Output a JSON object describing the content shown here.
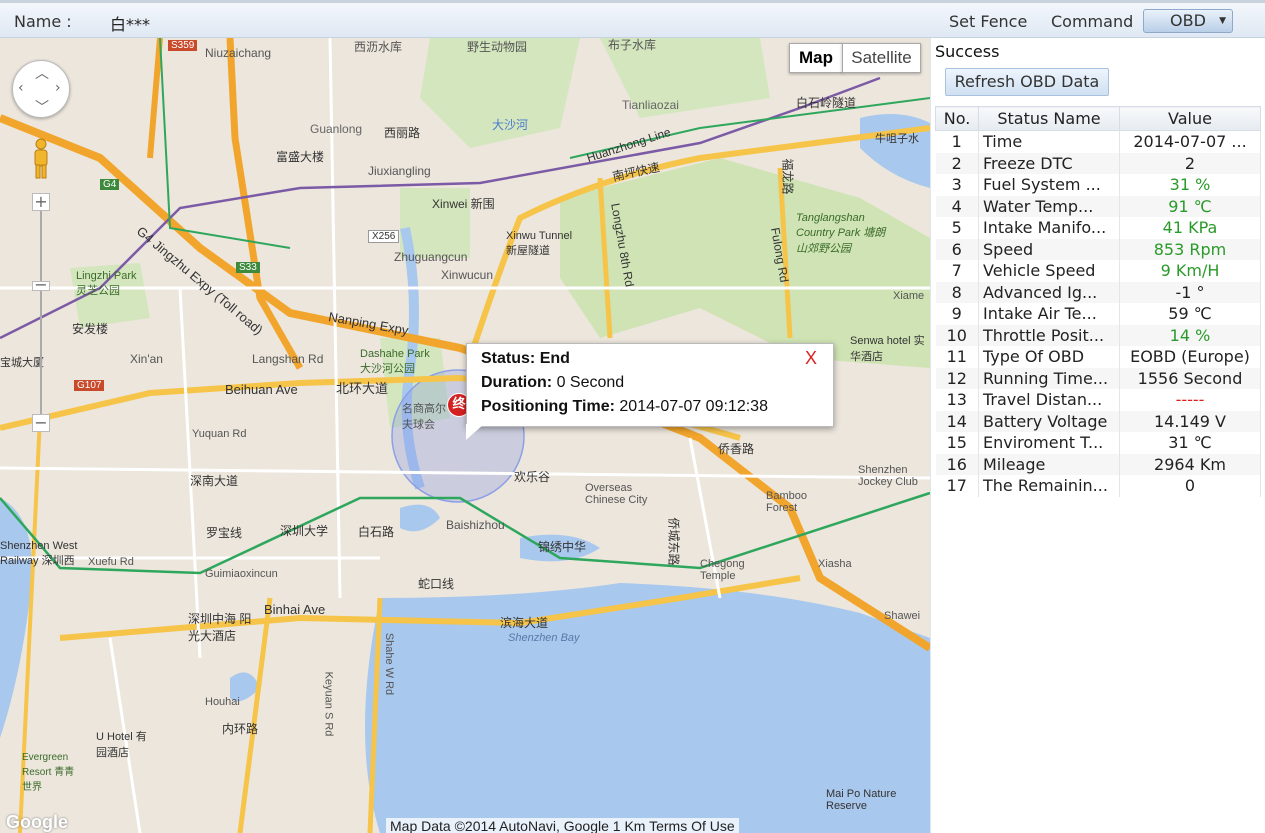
{
  "header": {
    "name_label": "Name :",
    "name_value": "白***",
    "set_fence": "Set Fence",
    "command": "Command",
    "obd_button": "OBD"
  },
  "map": {
    "type_map": "Map",
    "type_satellite": "Satellite",
    "infowindow": {
      "status_label": "Status:",
      "status_value": "End",
      "duration_label": "Duration:",
      "duration_value": "0 Second",
      "positioning_label": "Positioning Time:",
      "positioning_value": "2014-07-07 09:12:38",
      "close": "X"
    },
    "marker_text": "终",
    "google_logo": "Google",
    "footer": "Map Data ©2014 AutoNavi, Google  1 Km  Terms Of Use",
    "labels": [
      "Niuzaichang",
      "西沥水库",
      "野生动物园",
      "布子水库",
      "白石岭隧道",
      "Tianliaozai",
      "Guanlong",
      "西丽路",
      "富盛大楼",
      "Jiuxiangling",
      "Xinwei 新围",
      "大沙河",
      "Huanzhong Line",
      "南坪快速",
      "Xinwu Tunnel 新屋隧道",
      "Longzhu 8th Rd",
      "福龙路",
      "Fulong Rd",
      "Tanglangshan Country Park 塘朗山郊野公园",
      "牛咀子水",
      "Zhuguangcun",
      "Xinwucun",
      "Lingzhi Park 灵芝公园",
      "安发楼",
      "Xin'an",
      "Langshan Rd",
      "Dashahe Park 大沙河公园",
      "Nanping Expy",
      "G4 Jingzhu Expy (Toll road)",
      "Beihuan Ave",
      "北环大道",
      "名商高尔夫球会",
      "Yuquan Rd",
      "深南大道",
      "Overseas Chinese City",
      "欢乐谷",
      "侨香路",
      "Bamboo Forest",
      "Shenzhen Jockey Club",
      "深圳大学",
      "白石路",
      "Baishizhou",
      "锦绣中华",
      "罗宝线",
      "Shenzhen West Railway 深圳西",
      "Xuefu Rd",
      "Guimiaoxincun",
      "蛇口线",
      "侨城东路",
      "Chegong Temple",
      "Xiasha",
      "Binhai Ave",
      "深圳中海 阳光大酒店",
      "滨海大道",
      "Shenzhen Bay",
      "Houhai",
      "内环路",
      "U Hotel 有园酒店",
      "Evergreen Resort 青青世界",
      "Mai Po Nature Reserve",
      "Senwa hotel 实华酒店",
      "Xiame",
      "Shawei",
      "宝城大厦",
      "Keyuan S Rd",
      "Shahe W Rd",
      "G4",
      "S33",
      "S359",
      "G107",
      "X256"
    ]
  },
  "panel": {
    "status": "Success",
    "refresh_button": "Refresh OBD Data",
    "table_headers": [
      "No.",
      "Status Name",
      "Value"
    ],
    "rows": [
      {
        "no": "1",
        "name": "Time",
        "value": "2014-07-07 ...",
        "color": "normal"
      },
      {
        "no": "2",
        "name": "Freeze DTC",
        "value": "2",
        "color": "normal"
      },
      {
        "no": "3",
        "name": "Fuel System ...",
        "value": "31 %",
        "color": "green"
      },
      {
        "no": "4",
        "name": "Water Temp...",
        "value": "91 ℃",
        "color": "green"
      },
      {
        "no": "5",
        "name": "Intake Manifo...",
        "value": "41 KPa",
        "color": "green"
      },
      {
        "no": "6",
        "name": "Speed",
        "value": "853 Rpm",
        "color": "green"
      },
      {
        "no": "7",
        "name": "Vehicle Speed",
        "value": "9 Km/H",
        "color": "green"
      },
      {
        "no": "8",
        "name": "Advanced Ig...",
        "value": "-1 °",
        "color": "normal"
      },
      {
        "no": "9",
        "name": "Intake Air Te...",
        "value": "59 ℃",
        "color": "normal"
      },
      {
        "no": "10",
        "name": "Throttle Posit...",
        "value": "14 %",
        "color": "green"
      },
      {
        "no": "11",
        "name": "Type Of OBD",
        "value": "EOBD (Europe)",
        "color": "normal"
      },
      {
        "no": "12",
        "name": "Running Time...",
        "value": "1556 Second",
        "color": "normal"
      },
      {
        "no": "13",
        "name": "Travel Distan...",
        "value": "-----",
        "color": "red"
      },
      {
        "no": "14",
        "name": "Battery Voltage",
        "value": "14.149 V",
        "color": "normal"
      },
      {
        "no": "15",
        "name": "Enviroment T...",
        "value": "31 ℃",
        "color": "normal"
      },
      {
        "no": "16",
        "name": "Mileage",
        "value": "2964 Km",
        "color": "normal"
      },
      {
        "no": "17",
        "name": "The Remainin...",
        "value": "0",
        "color": "normal"
      }
    ]
  }
}
